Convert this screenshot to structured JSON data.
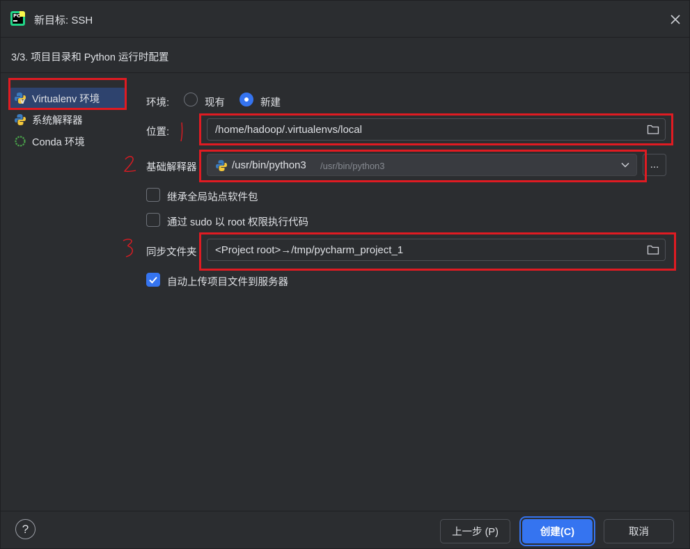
{
  "window": {
    "title": "新目标: SSH",
    "step_title": "3/3. 项目目录和 Python 运行时配置"
  },
  "sidebar": {
    "items": [
      {
        "label": "Virtualenv 环境",
        "icon": "virtualenv-icon",
        "selected": true
      },
      {
        "label": "系统解释器",
        "icon": "python-icon",
        "selected": false
      },
      {
        "label": "Conda 环境",
        "icon": "conda-icon",
        "selected": false
      }
    ]
  },
  "form": {
    "env_label": "环境:",
    "env_options": [
      {
        "label": "现有",
        "selected": false
      },
      {
        "label": "新建",
        "selected": true
      }
    ],
    "location_label": "位置:",
    "location_value": "/home/hadoop/.virtualenvs/local",
    "base_interpreter_label": "基础解释器",
    "base_interpreter_value": "/usr/bin/python3",
    "base_interpreter_hint": "/usr/bin/python3",
    "browse_button_label": "...",
    "inherit_label": "继承全局站点软件包",
    "inherit_checked": false,
    "sudo_label": "通过 sudo 以 root 权限执行代码",
    "sudo_checked": false,
    "sync_label": "同步文件夹",
    "sync_value": "<Project root>→/tmp/pycharm_project_1",
    "auto_upload_label": "自动上传项目文件到服务器",
    "auto_upload_checked": true
  },
  "footer": {
    "help_label": "?",
    "back_label": "上一步 (P)",
    "create_label": "创建(C)",
    "cancel_label": "取消"
  },
  "colors": {
    "background": "#2b2d30",
    "accent": "#3574f0",
    "selection": "#2e436e",
    "annotation_red": "#e01b22"
  }
}
